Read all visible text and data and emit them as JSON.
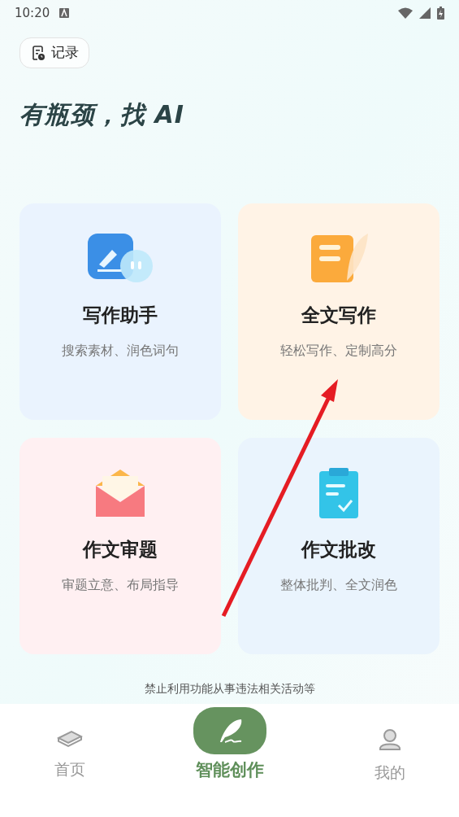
{
  "status_bar": {
    "time": "10:20"
  },
  "history_button": {
    "label": "记录"
  },
  "headline": "有瓶颈，找 AI",
  "cards": [
    {
      "kind": "assistant",
      "title": "写作助手",
      "subtitle": "搜索素材、润色词句"
    },
    {
      "kind": "fulltext",
      "title": "全文写作",
      "subtitle": "轻松写作、定制高分"
    },
    {
      "kind": "topic",
      "title": "作文审题",
      "subtitle": "审题立意、布局指导"
    },
    {
      "kind": "correct",
      "title": "作文批改",
      "subtitle": "整体批判、全文润色"
    }
  ],
  "disclaimer": "禁止利用功能从事违法相关活动等",
  "nav": [
    {
      "kind": "home",
      "label": "首页",
      "selected": false
    },
    {
      "kind": "create",
      "label": "智能创作",
      "selected": true
    },
    {
      "kind": "mine",
      "label": "我的",
      "selected": false
    }
  ]
}
